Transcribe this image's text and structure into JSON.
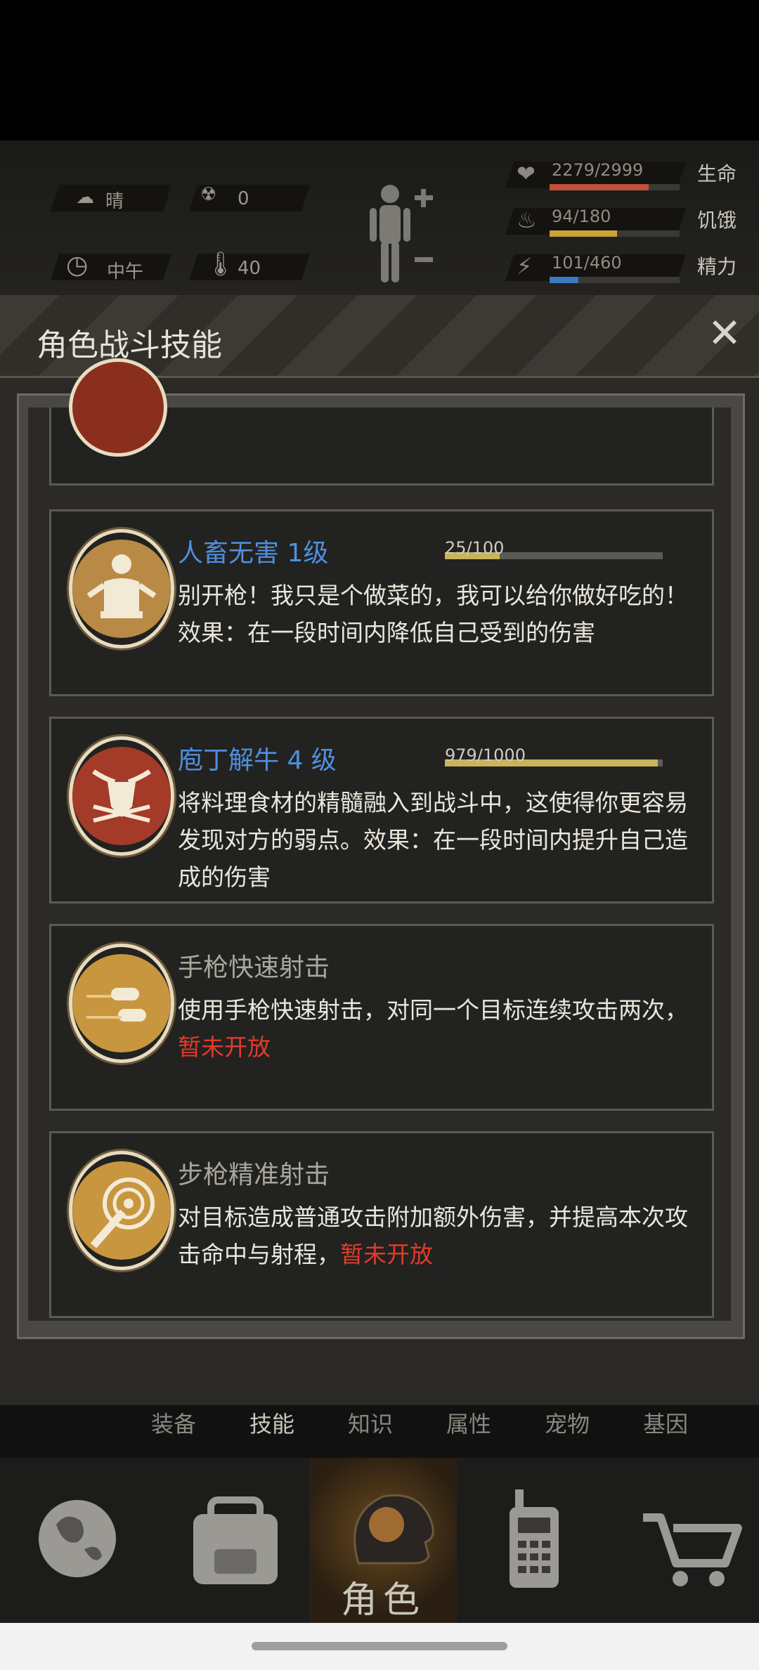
{
  "status": {
    "weather": "晴",
    "radiation": "0",
    "time_of_day": "中午",
    "temperature": "40",
    "stats": [
      {
        "label": "生命",
        "value": "2279/2999",
        "fraction": 0.76,
        "color": "#c0503a"
      },
      {
        "label": "饥饿",
        "value": "94/180",
        "fraction": 0.52,
        "color": "#c8a43a"
      },
      {
        "label": "精力",
        "value": "101/460",
        "fraction": 0.22,
        "color": "#3a7ac0"
      }
    ]
  },
  "panel": {
    "title": "角色战斗技能",
    "close_symbol": "✕"
  },
  "skills": [
    {
      "name": "人畜无害 1级",
      "progress_text": "25/100",
      "progress": 0.25,
      "desc": "别开枪！我只是个做菜的，我可以给你做好吃的！效果：在一段时间内降低自己受到的伤害",
      "locked_text": "",
      "name_color": "#4f8fe0",
      "icon": "chef-shrug-icon"
    },
    {
      "name": "庖丁解牛 4 级",
      "progress_text": "979/1000",
      "progress": 0.979,
      "desc": "将料理食材的精髓融入到战斗中，这使得你更容易发现对方的弱点。效果：在一段时间内提升自己造成的伤害",
      "locked_text": "",
      "name_color": "#4f8fe0",
      "icon": "bull-skull-knives-icon"
    },
    {
      "name": "手枪快速射击",
      "progress_text": "",
      "desc": "使用手枪快速射击，对同一个目标连续攻击两次，",
      "locked_text": "暂未开放",
      "name_color": "#a9a69c",
      "icon": "bullets-icon"
    },
    {
      "name": "步枪精准射击",
      "progress_text": "",
      "desc": "对目标造成普通攻击附加额外伤害，并提高本次攻击命中与射程，",
      "locked_text": "暂未开放",
      "name_color": "#a9a69c",
      "icon": "target-bullet-icon"
    }
  ],
  "subtabs": [
    "装备",
    "技能",
    "知识",
    "属性",
    "宠物",
    "基因"
  ],
  "bottom_nav": {
    "active_label": "角色",
    "items": [
      "globe-icon",
      "backpack-icon",
      "character-icon",
      "walkie-talkie-icon",
      "cart-icon"
    ]
  }
}
